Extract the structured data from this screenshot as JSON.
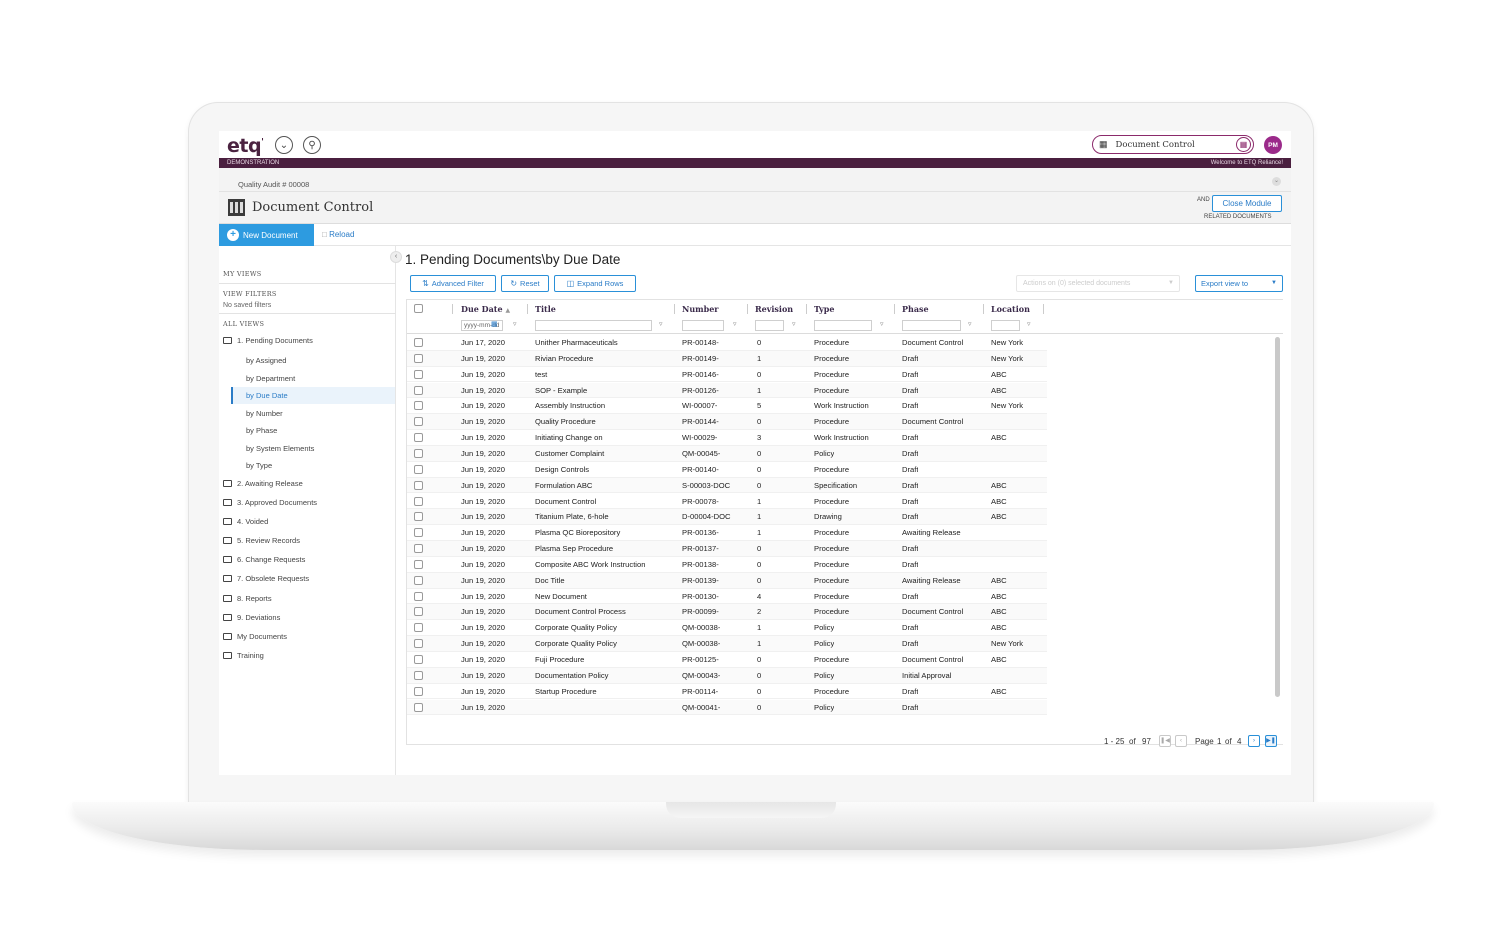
{
  "brand": {
    "logo": "etq",
    "logo_mark": "'"
  },
  "header": {
    "module_select_label": "Document Control",
    "avatar_initials": "PM",
    "env_label": "DEMONSTRATION",
    "welcome": "Welcome to ETQ Reliance!"
  },
  "breadcrumb": {
    "text": "Quality Audit # 00008"
  },
  "module": {
    "title": "Document Control",
    "and_label": "AND",
    "close_label": "Close Module",
    "related_label": "RELATED DOCUMENTS"
  },
  "toolbar": {
    "new_document": "New Document",
    "reload": "Reload"
  },
  "sidebar": {
    "my_views": "MY VIEWS",
    "view_filters": "VIEW FILTERS",
    "no_saved": "No saved filters",
    "all_views": "ALL VIEWS",
    "folders": [
      {
        "label": "1. Pending Documents"
      },
      {
        "label": "2. Awaiting Release"
      },
      {
        "label": "3. Approved Documents"
      },
      {
        "label": "4. Voided"
      },
      {
        "label": "5. Review Records"
      },
      {
        "label": "6. Change Requests"
      },
      {
        "label": "7. Obsolete Requests"
      },
      {
        "label": "8. Reports"
      },
      {
        "label": "9. Deviations"
      },
      {
        "label": "My Documents"
      },
      {
        "label": "Training"
      }
    ],
    "subviews": [
      "by Assigned",
      "by Department",
      "by Due Date",
      "by Number",
      "by Phase",
      "by System Elements",
      "by Type"
    ]
  },
  "view": {
    "title": "1. Pending Documents\\by Due Date",
    "advanced_filter": "Advanced Filter",
    "reset": "Reset",
    "expand_rows": "Expand Rows",
    "actions_placeholder": "Actions on (0) selected documents",
    "export": "Export view to",
    "date_filter_placeholder": "yyyy-mm-dd"
  },
  "columns": {
    "due_date": "Due Date",
    "title": "Title",
    "number": "Number",
    "revision": "Revision",
    "type": "Type",
    "phase": "Phase",
    "location": "Location"
  },
  "rows": [
    {
      "due": "Jun 17, 2020",
      "title": "Unither Pharmaceuticals",
      "number": "PR-00148-",
      "rev": "0",
      "type": "Procedure",
      "phase": "Document Control",
      "loc": "New York"
    },
    {
      "due": "Jun 19, 2020",
      "title": "Rivian Procedure",
      "number": "PR-00149-",
      "rev": "1",
      "type": "Procedure",
      "phase": "Draft",
      "loc": "New York"
    },
    {
      "due": "Jun 19, 2020",
      "title": "test",
      "number": "PR-00146-",
      "rev": "0",
      "type": "Procedure",
      "phase": "Draft",
      "loc": "ABC"
    },
    {
      "due": "Jun 19, 2020",
      "title": "SOP - Example",
      "number": "PR-00126-",
      "rev": "1",
      "type": "Procedure",
      "phase": "Draft",
      "loc": "ABC"
    },
    {
      "due": "Jun 19, 2020",
      "title": "Assembly Instruction",
      "number": "WI-00007-",
      "rev": "5",
      "type": "Work Instruction",
      "phase": "Draft",
      "loc": "New York"
    },
    {
      "due": "Jun 19, 2020",
      "title": "Quality Procedure",
      "number": "PR-00144-",
      "rev": "0",
      "type": "Procedure",
      "phase": "Document Control",
      "loc": ""
    },
    {
      "due": "Jun 19, 2020",
      "title": "Initiating Change on",
      "number": "WI-00029-",
      "rev": "3",
      "type": "Work Instruction",
      "phase": "Draft",
      "loc": "ABC"
    },
    {
      "due": "Jun 19, 2020",
      "title": "Customer Complaint",
      "number": "QM-00045-",
      "rev": "0",
      "type": "Policy",
      "phase": "Draft",
      "loc": ""
    },
    {
      "due": "Jun 19, 2020",
      "title": "Design Controls",
      "number": "PR-00140-",
      "rev": "0",
      "type": "Procedure",
      "phase": "Draft",
      "loc": ""
    },
    {
      "due": "Jun 19, 2020",
      "title": "Formulation ABC",
      "number": "S-00003-DOC",
      "rev": "0",
      "type": "Specification",
      "phase": "Draft",
      "loc": "ABC"
    },
    {
      "due": "Jun 19, 2020",
      "title": "Document Control",
      "number": "PR-00078-",
      "rev": "1",
      "type": "Procedure",
      "phase": "Draft",
      "loc": "ABC"
    },
    {
      "due": "Jun 19, 2020",
      "title": "Titanium Plate, 6-hole",
      "number": "D-00004-DOC",
      "rev": "1",
      "type": "Drawing",
      "phase": "Draft",
      "loc": "ABC"
    },
    {
      "due": "Jun 19, 2020",
      "title": "Plasma QC Biorepository",
      "number": "PR-00136-",
      "rev": "1",
      "type": "Procedure",
      "phase": "Awaiting Release",
      "loc": ""
    },
    {
      "due": "Jun 19, 2020",
      "title": "Plasma Sep Procedure",
      "number": "PR-00137-",
      "rev": "0",
      "type": "Procedure",
      "phase": "Draft",
      "loc": ""
    },
    {
      "due": "Jun 19, 2020",
      "title": "Composite ABC Work Instruction",
      "number": "PR-00138-",
      "rev": "0",
      "type": "Procedure",
      "phase": "Draft",
      "loc": ""
    },
    {
      "due": "Jun 19, 2020",
      "title": "Doc Title",
      "number": "PR-00139-",
      "rev": "0",
      "type": "Procedure",
      "phase": "Awaiting Release",
      "loc": "ABC"
    },
    {
      "due": "Jun 19, 2020",
      "title": "New Document",
      "number": "PR-00130-",
      "rev": "4",
      "type": "Procedure",
      "phase": "Draft",
      "loc": "ABC"
    },
    {
      "due": "Jun 19, 2020",
      "title": "Document Control Process",
      "number": "PR-00099-",
      "rev": "2",
      "type": "Procedure",
      "phase": "Document Control",
      "loc": "ABC"
    },
    {
      "due": "Jun 19, 2020",
      "title": "Corporate Quality Policy",
      "number": "QM-00038-",
      "rev": "1",
      "type": "Policy",
      "phase": "Draft",
      "loc": "ABC"
    },
    {
      "due": "Jun 19, 2020",
      "title": "Corporate Quality Policy",
      "number": "QM-00038-",
      "rev": "1",
      "type": "Policy",
      "phase": "Draft",
      "loc": "New York"
    },
    {
      "due": "Jun 19, 2020",
      "title": "Fuji Procedure",
      "number": "PR-00125-",
      "rev": "0",
      "type": "Procedure",
      "phase": "Document Control",
      "loc": "ABC"
    },
    {
      "due": "Jun 19, 2020",
      "title": "Documentation Policy",
      "number": "QM-00043-",
      "rev": "0",
      "type": "Policy",
      "phase": "Initial Approval",
      "loc": ""
    },
    {
      "due": "Jun 19, 2020",
      "title": "Startup Procedure",
      "number": "PR-00114-",
      "rev": "0",
      "type": "Procedure",
      "phase": "Draft",
      "loc": "ABC"
    },
    {
      "due": "Jun 19, 2020",
      "title": "",
      "number": "QM-00041-",
      "rev": "0",
      "type": "Policy",
      "phase": "Draft",
      "loc": ""
    }
  ],
  "pager": {
    "range": "1 - 25",
    "of_label": "of",
    "total": "97",
    "page_label": "Page",
    "page": "1",
    "page_of": "of",
    "pages": "4"
  }
}
